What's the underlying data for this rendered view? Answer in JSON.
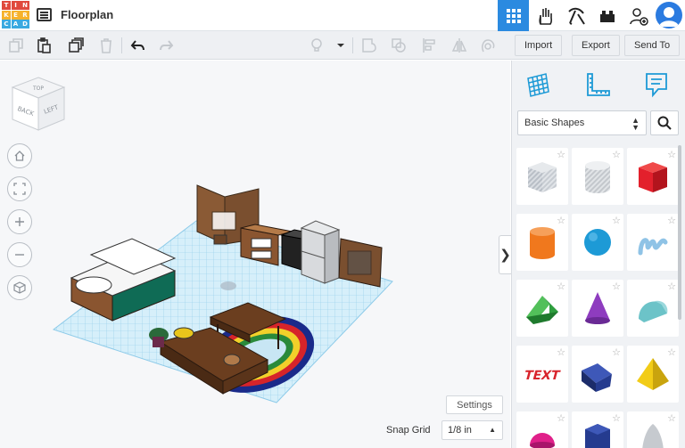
{
  "app": {
    "logo_letters": [
      "T",
      "I",
      "N",
      "K",
      "E",
      "R",
      "C",
      "A",
      "D"
    ],
    "logo_colors": [
      "#e0493d",
      "#e0493d",
      "#e0493d",
      "#f6b22b",
      "#f6b22b",
      "#f6b22b",
      "#3aa9e0",
      "#3aa9e0",
      "#3aa9e0"
    ],
    "document_title": "Floorplan"
  },
  "topnav": {
    "items": [
      {
        "icon": "3d-design-grid-icon",
        "active": true
      },
      {
        "icon": "circuits-hand-icon",
        "active": false
      },
      {
        "icon": "pickaxe-icon",
        "active": false
      },
      {
        "icon": "blocks-icon",
        "active": false
      },
      {
        "icon": "add-user-icon",
        "active": false
      }
    ],
    "accent": "#2b8ae0"
  },
  "toolbar": {
    "import_label": "Import",
    "export_label": "Export",
    "sendto_label": "Send To"
  },
  "workplane": {
    "view_cube_faces": [
      "TOP",
      "BACK",
      "LEFT"
    ],
    "settings_label": "Settings",
    "snap_grid_label": "Snap Grid",
    "snap_grid_value": "1/8 in",
    "collapse_glyph": "❯"
  },
  "panel": {
    "library_value": "Basic Shapes",
    "shapes": [
      {
        "name": "box-hole",
        "color": "#b8bec6"
      },
      {
        "name": "cylinder-hole",
        "color": "#c3c7cc"
      },
      {
        "name": "box",
        "color": "#e3202c"
      },
      {
        "name": "cylinder",
        "color": "#f0781d"
      },
      {
        "name": "sphere",
        "color": "#1d9ad6"
      },
      {
        "name": "scribble",
        "color": "#8fc3e6"
      },
      {
        "name": "roof",
        "color": "#2e9e3e"
      },
      {
        "name": "cone",
        "color": "#8e3cbf"
      },
      {
        "name": "round-roof",
        "color": "#6cc3c8"
      },
      {
        "name": "text",
        "color": "#d8242c"
      },
      {
        "name": "wedge",
        "color": "#253b8f"
      },
      {
        "name": "pyramid",
        "color": "#f2cc17"
      },
      {
        "name": "half-sphere",
        "color": "#e0208a"
      },
      {
        "name": "polygon",
        "color": "#253b8f"
      },
      {
        "name": "paraboloid",
        "color": "#c6cacf"
      }
    ]
  }
}
